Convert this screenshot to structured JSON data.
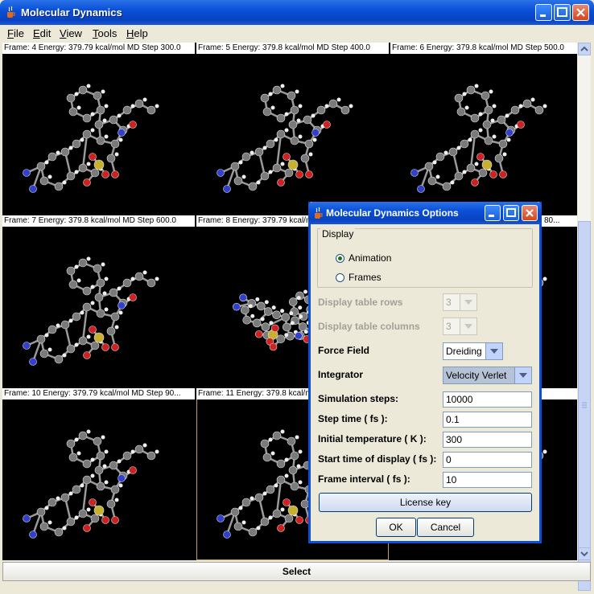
{
  "window": {
    "title": "Molecular Dynamics"
  },
  "menu": [
    {
      "label": "File",
      "key": "F",
      "rest": "ile"
    },
    {
      "label": "Edit",
      "key": "E",
      "rest": "dit"
    },
    {
      "label": "View",
      "key": "V",
      "rest": "iew"
    },
    {
      "label": "Tools",
      "key": "T",
      "rest": "ools"
    },
    {
      "label": "Help",
      "key": "H",
      "rest": "elp"
    }
  ],
  "frames": [
    {
      "caption": "Frame: 4  Energy: 379.79 kcal/mol MD Step 300.0"
    },
    {
      "caption": "Frame: 5  Energy: 379.8 kcal/mol MD Step 400.0"
    },
    {
      "caption": "Frame: 6  Energy: 379.8 kcal/mol MD Step 500.0"
    },
    {
      "caption": "Frame: 7  Energy: 379.8 kcal/mol MD Step 600.0"
    },
    {
      "caption": "Frame: 8  Energy: 379.79 kcal/mol MD Step 700.0"
    },
    {
      "caption": "Frame: 9  Energy: 379.8 kcal/mol MD Step 80..."
    },
    {
      "caption": "Frame: 10  Energy: 379.79 kcal/mol MD Step 90..."
    },
    {
      "caption": "Frame: 11  Energy: 379.8 kcal/mol MD Step 1000.0"
    },
    {
      "caption": ""
    }
  ],
  "select_button": "Select",
  "dialog": {
    "title": "Molecular Dynamics Options",
    "display_group": "Display",
    "radio_animation": "Animation",
    "radio_frames": "Frames",
    "selected_mode": "Animation",
    "rows_label": "Display table rows",
    "rows_value": "3",
    "cols_label": "Display table columns",
    "cols_value": "3",
    "force_field_label": "Force Field",
    "force_field_value": "Dreiding",
    "integrator_label": "Integrator",
    "integrator_value": "Velocity Verlet",
    "steps_label": "Simulation steps:",
    "steps_value": "10000",
    "step_time_label": "Step time ( fs ):",
    "step_time_value": "0.1",
    "temp_label": "Initial temperature ( K ):",
    "temp_value": "300",
    "start_label": "Start time of display ( fs ):",
    "start_value": "0",
    "interval_label": "Frame interval ( fs ):",
    "interval_value": "10",
    "license_button": "License key",
    "ok_button": "OK",
    "cancel_button": "Cancel"
  },
  "icons": {
    "app": "java-cup-icon",
    "minimize": "minimize-icon",
    "maximize": "maximize-icon",
    "close": "close-icon"
  }
}
